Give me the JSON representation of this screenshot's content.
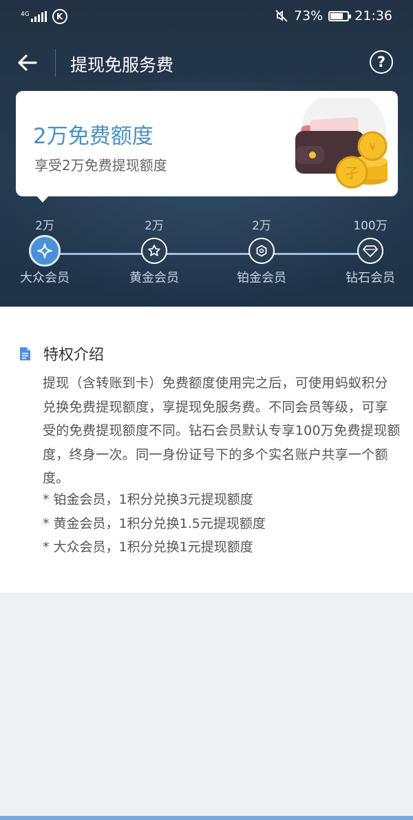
{
  "status_bar": {
    "network": "4G",
    "network_sub": "1",
    "carrier_icon": "k-circle-icon",
    "battery_percent": "73%",
    "battery_level": 0.73,
    "time": "21:36",
    "mute_icon": "mute-icon"
  },
  "nav": {
    "title": "提现免服务费",
    "back_icon": "arrow-left-icon",
    "help_label": "?"
  },
  "card": {
    "title": "2万免费额度",
    "subtitle": "享受2万免费提现额度",
    "illustration": "wallet-coins-icon",
    "coin_char": "孑"
  },
  "tiers": [
    {
      "amount": "2万",
      "label": "大众会员",
      "icon": "sparkle-icon",
      "active": true
    },
    {
      "amount": "2万",
      "label": "黄金会员",
      "icon": "star-icon",
      "active": false
    },
    {
      "amount": "2万",
      "label": "铂金会员",
      "icon": "hexagon-icon",
      "active": false
    },
    {
      "amount": "100万",
      "label": "钻石会员",
      "icon": "diamond-icon",
      "active": false
    }
  ],
  "privilege": {
    "title": "特权介绍",
    "description": "提现（含转账到卡）免费额度使用完之后，可使用蚂蚁积分兑换免费提现额度，享提现免服务费。不同会员等级，可享受的免费提现额度不同。钻石会员默认专享100万免费提现额度，终身一次。同一身份证号下的多个实名账户共享一个额度。",
    "rules": [
      "* 铂金会员，1积分兑换3元提现额度",
      "* 黄金会员，1积分兑换1.5元提现额度",
      "* 大众会员，1积分兑换1元提现额度"
    ]
  },
  "colors": {
    "header_bg": "#223244",
    "accent_blue": "#4a90c2",
    "active_tier": "#4a90d9"
  }
}
